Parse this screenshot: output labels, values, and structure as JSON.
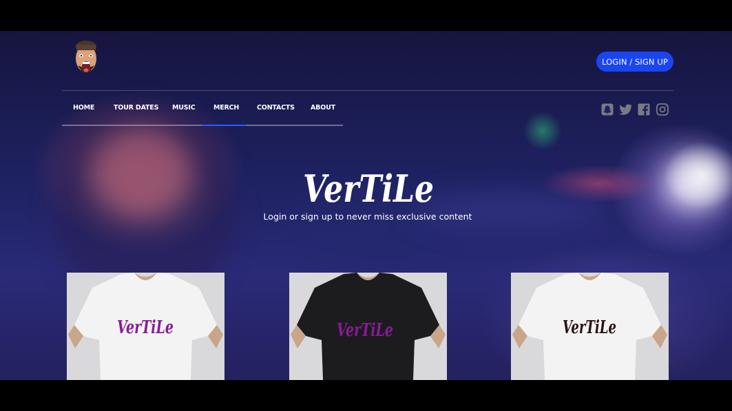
{
  "header": {
    "login_label": "LOGIN / SIGN UP"
  },
  "nav": {
    "items": [
      {
        "label": "HOME"
      },
      {
        "label": "TOUR DATES"
      },
      {
        "label": "MUSIC"
      },
      {
        "label": "MERCH",
        "active": true
      },
      {
        "label": "CONTACTS"
      },
      {
        "label": "ABOUT"
      }
    ]
  },
  "social": {
    "icons": [
      "snapchat-icon",
      "twitter-icon",
      "facebook-icon",
      "instagram-icon"
    ],
    "color": "#7a7a85"
  },
  "hero": {
    "brand": "VerTiLe",
    "tagline": "Login or sign up to never miss exclusive content"
  },
  "products": [
    {
      "shirt_color": "#f3f3f3",
      "print_color": "#8a1a9a",
      "print_text": "VerTiLe"
    },
    {
      "shirt_color": "#1c1c1e",
      "print_color": "#8a1a9a",
      "print_text": "VerTiLe"
    },
    {
      "shirt_color": "#f3f3f3",
      "print_color": "#2a1210",
      "print_text": "VerTiLe"
    }
  ],
  "colors": {
    "accent": "#1a45f0",
    "active_underline": "#2a5cff"
  }
}
